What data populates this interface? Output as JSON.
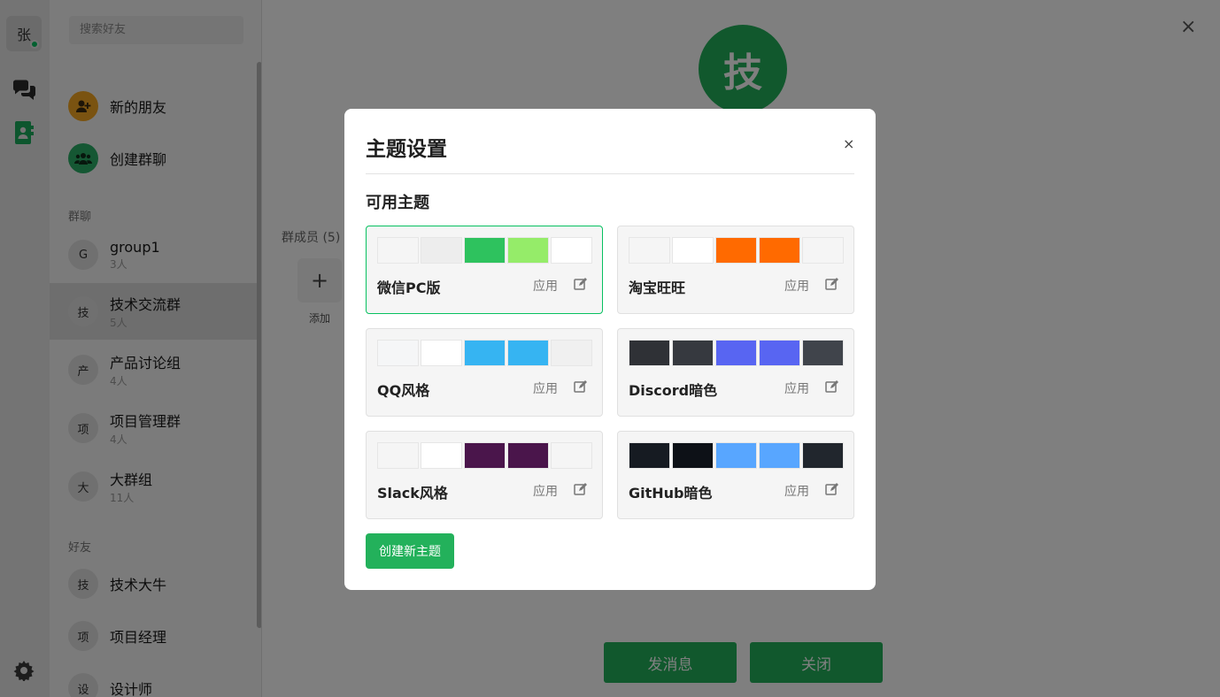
{
  "rail": {
    "me_avatar": "张",
    "icons": [
      "chat-icon",
      "contacts-icon",
      "settings-icon"
    ]
  },
  "search": {
    "placeholder": "搜索好友"
  },
  "actions": [
    {
      "label": "新的朋友",
      "icon": "add-friend-icon"
    },
    {
      "label": "创建群聊",
      "icon": "group-icon"
    }
  ],
  "sections": {
    "groups": "群聊",
    "friends": "好友"
  },
  "groups": [
    {
      "avatar": "G",
      "name": "group1",
      "count": "3人"
    },
    {
      "avatar": "技",
      "name": "技术交流群",
      "count": "5人"
    },
    {
      "avatar": "产",
      "name": "产品讨论组",
      "count": "4人"
    },
    {
      "avatar": "项",
      "name": "项目管理群",
      "count": "4人"
    },
    {
      "avatar": "大",
      "name": "大群组",
      "count": "11人"
    }
  ],
  "friends": [
    {
      "avatar": "技",
      "name": "技术大牛"
    },
    {
      "avatar": "项",
      "name": "项目经理"
    },
    {
      "avatar": "设",
      "name": "设计师"
    }
  ],
  "main": {
    "group_avatar": "技",
    "members_label": "群成员 (5)",
    "add_label": "添加",
    "send_button": "发消息",
    "close_button": "关闭",
    "close_icon": "×"
  },
  "modal": {
    "title": "主题设置",
    "close": "×",
    "section": "可用主题",
    "apply_label": "应用",
    "create_button": "创建新主题",
    "themes": [
      {
        "name": "微信PC版",
        "selected": true,
        "colors": [
          "#f5f5f5",
          "#ededed",
          "#2ec25e",
          "#95ec69",
          "#ffffff"
        ]
      },
      {
        "name": "淘宝旺旺",
        "selected": false,
        "colors": [
          "#f5f5f5",
          "#ffffff",
          "#ff6a00",
          "#ff6a00",
          "#f5f5f5"
        ]
      },
      {
        "name": "QQ风格",
        "selected": false,
        "colors": [
          "#f5f6f7",
          "#ffffff",
          "#36b4f2",
          "#36b4f2",
          "#f0f0f0"
        ]
      },
      {
        "name": "Discord暗色",
        "selected": false,
        "colors": [
          "#2f3136",
          "#36393f",
          "#5865f2",
          "#5865f2",
          "#40444b"
        ]
      },
      {
        "name": "Slack风格",
        "selected": false,
        "colors": [
          "#f5f5f5",
          "#ffffff",
          "#4a154b",
          "#4a154b",
          "#f5f5f5"
        ]
      },
      {
        "name": "GitHub暗色",
        "selected": false,
        "colors": [
          "#161b22",
          "#0d1117",
          "#58a6ff",
          "#58a6ff",
          "#21262d"
        ]
      }
    ]
  }
}
